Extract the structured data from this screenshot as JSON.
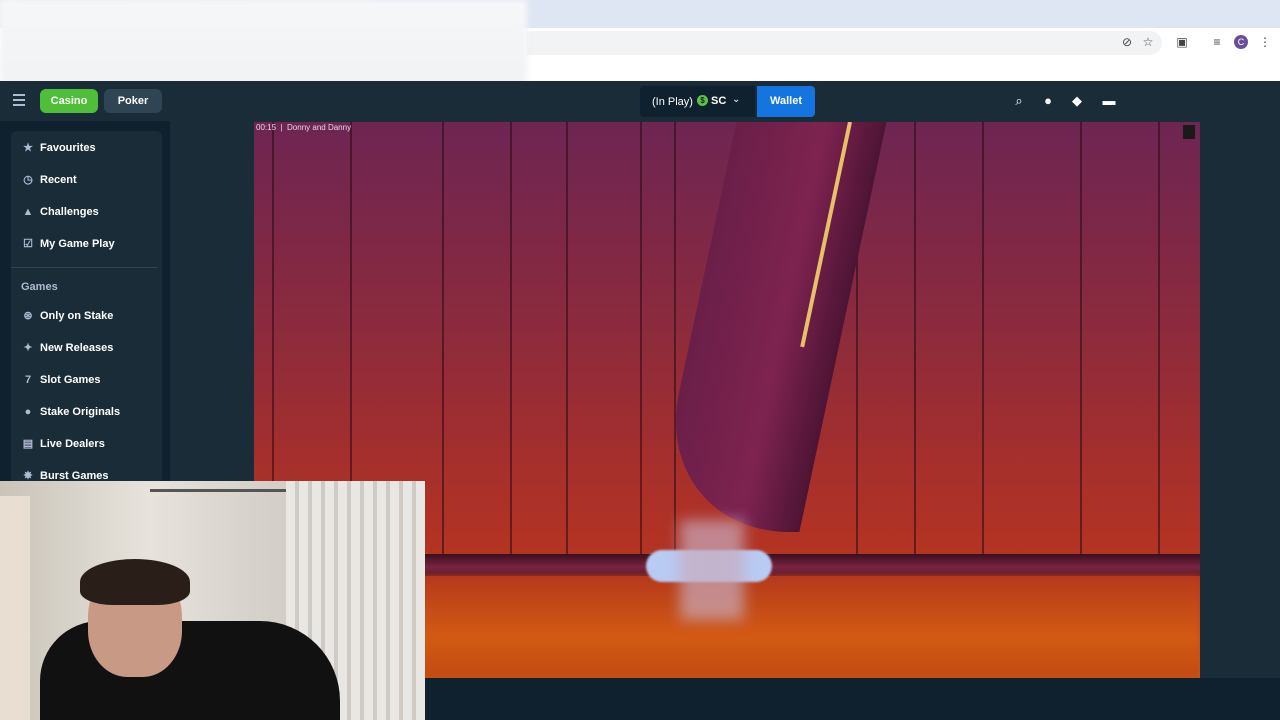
{
  "browser": {
    "new_tab_label": "+",
    "profile_initial": "C",
    "icons": [
      "mute-icon",
      "star-icon",
      "extension-icon",
      "media-icon",
      "menu-dots-icon"
    ]
  },
  "header": {
    "casino_label": "Casino",
    "poker_label": "Poker",
    "inplay_label": "(In Play)",
    "currency_badge": "$",
    "currency_label": "SC",
    "wallet_label": "Wallet",
    "accent": "#1475e1",
    "casino_color": "#4fbf3a"
  },
  "sidebar": {
    "items": [
      {
        "label": "Favourites",
        "icon": "star-icon"
      },
      {
        "label": "Recent",
        "icon": "clock-icon"
      },
      {
        "label": "Challenges",
        "icon": "cone-icon"
      },
      {
        "label": "My Game Play",
        "icon": "checkbox-icon"
      }
    ],
    "section_title": "Games",
    "games": [
      {
        "label": "Only on Stake",
        "icon": "stake-icon"
      },
      {
        "label": "New Releases",
        "icon": "sparkle-icon"
      },
      {
        "label": "Slot Games",
        "icon": "slot-icon"
      },
      {
        "label": "Stake Originals",
        "icon": "flame-icon"
      },
      {
        "label": "Live Dealers",
        "icon": "dealer-icon"
      },
      {
        "label": "Burst Games",
        "icon": "burst-icon"
      }
    ]
  },
  "game": {
    "timer": "00:15",
    "title": "Donny and Danny"
  }
}
